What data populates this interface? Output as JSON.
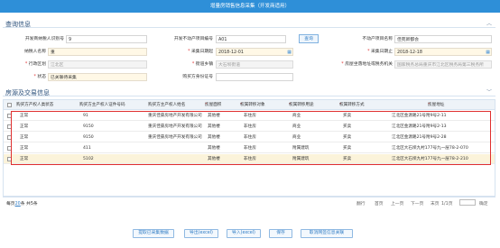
{
  "title": "增量房销售信息采集（开发商适用）",
  "basic_section": {
    "title": "查询信息",
    "collapse_icon": "chevron-up-icon"
  },
  "form": {
    "row1": {
      "seller_id_label": "开发商纳税人识别号",
      "seller_id_value": "9",
      "contract_no_label": "开发不动产项目编号",
      "contract_no_value": "A01",
      "query_btn": "查询",
      "project_name_label": "不动产项目名称",
      "project_name_value": "佳苑新都会"
    },
    "row2": {
      "tax_name_label": "纳税人名称",
      "tax_name_value": "重",
      "start_date_label": "采集日期起",
      "start_date_value": "2018-12-01",
      "end_date_label": "采集日期止",
      "end_date_value": "2018-12-18"
    },
    "row3": {
      "district_label": "行政区划",
      "district_value": "江北区",
      "street_label": "街道乡镇",
      "street_value": "大石坝街道",
      "address_label": "房屋坐落地址或税务机关",
      "address_value": "国家税务总局重庆市江北区税务局第三税务所"
    },
    "row4": {
      "status_label": "状态",
      "status_value": "已关联待采集",
      "cert_label": "购买方身份证号",
      "cert_value": ""
    }
  },
  "house_section": {
    "title": "房源及交易信息",
    "collapse_icon": "chevron-down-icon"
  },
  "grid": {
    "columns": [
      "购买方产权人类状态",
      "购买方主产权人证件号码",
      "购买方主产权人姓名",
      "房屋面积",
      "权属转移对象",
      "权属转移用途",
      "权属转移方式",
      "房屋地址"
    ],
    "required": [
      false,
      false,
      false,
      true,
      true,
      true,
      true,
      true
    ],
    "rows": [
      [
        "正常",
        "91",
        "重庆佳豪房地产开发有限公司",
        "其他楼",
        "非住房",
        "商业",
        "买卖",
        "江北区金源路21号附9号2-11"
      ],
      [
        "正常",
        "9150",
        "重庆佳豪房地产开发有限公司",
        "其他楼",
        "非住房",
        "商业",
        "买卖",
        "江北区金源路21号附9号2-13"
      ],
      [
        "正常",
        "9150",
        "重庆佳豪房地产开发有限公司",
        "其他楼",
        "非住房",
        "商业",
        "买卖",
        "江北区金源路21号附9号2-28"
      ],
      [
        "正常",
        "411",
        "",
        "其他楼",
        "非住房",
        "附属建筑",
        "买卖",
        "江北区大石坝九村177号九一层78-2-070"
      ],
      [
        "正常",
        "5102",
        "",
        "其他楼",
        "非住房",
        "附属建筑",
        "买卖",
        "江北区大石坝九村177号九一层78-2-210"
      ]
    ]
  },
  "pager": {
    "left_prefix": "每页",
    "per_page": "20",
    "left_suffix": "条 共5条",
    "labels": [
      "翻行",
      "首页",
      "上一页",
      "下一页",
      "末页",
      "1/1页",
      "确定"
    ]
  },
  "buttons": [
    "提取已采集数据",
    "导出(excel)",
    "导入(excel)",
    "保存",
    "取消网签信息关联"
  ]
}
